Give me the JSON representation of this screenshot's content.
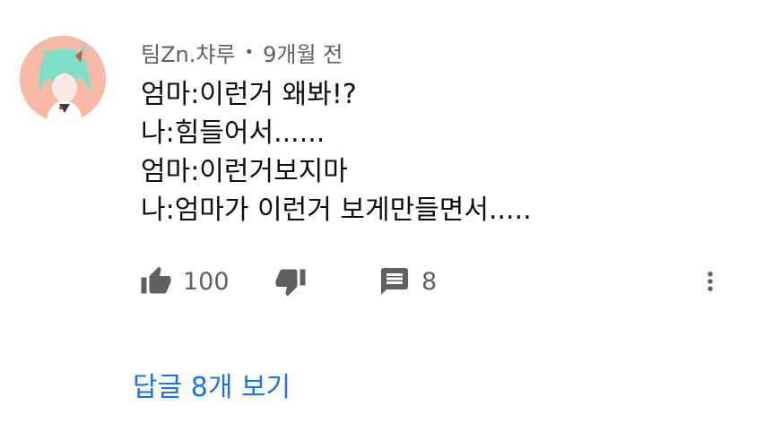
{
  "comment": {
    "author": "팀Zn.챠루",
    "separator": "•",
    "time": "9개월 전",
    "lines": [
      "엄마:이런거 왜봐!?",
      "나:힘들어서......",
      "엄마:이런거보지마",
      "나:엄마가 이런거 보게만들면서....."
    ]
  },
  "actions": {
    "like_count": "100",
    "reply_count": "8"
  },
  "replies": {
    "view_label": "답글 8개 보기"
  },
  "colors": {
    "secondary_text": "#606060",
    "link_blue": "#1a73e8",
    "avatar_bg": "#f7b8a4"
  },
  "icons": [
    "avatar",
    "thumb-up-icon",
    "thumb-down-icon",
    "comment-icon",
    "more-vert-icon"
  ]
}
